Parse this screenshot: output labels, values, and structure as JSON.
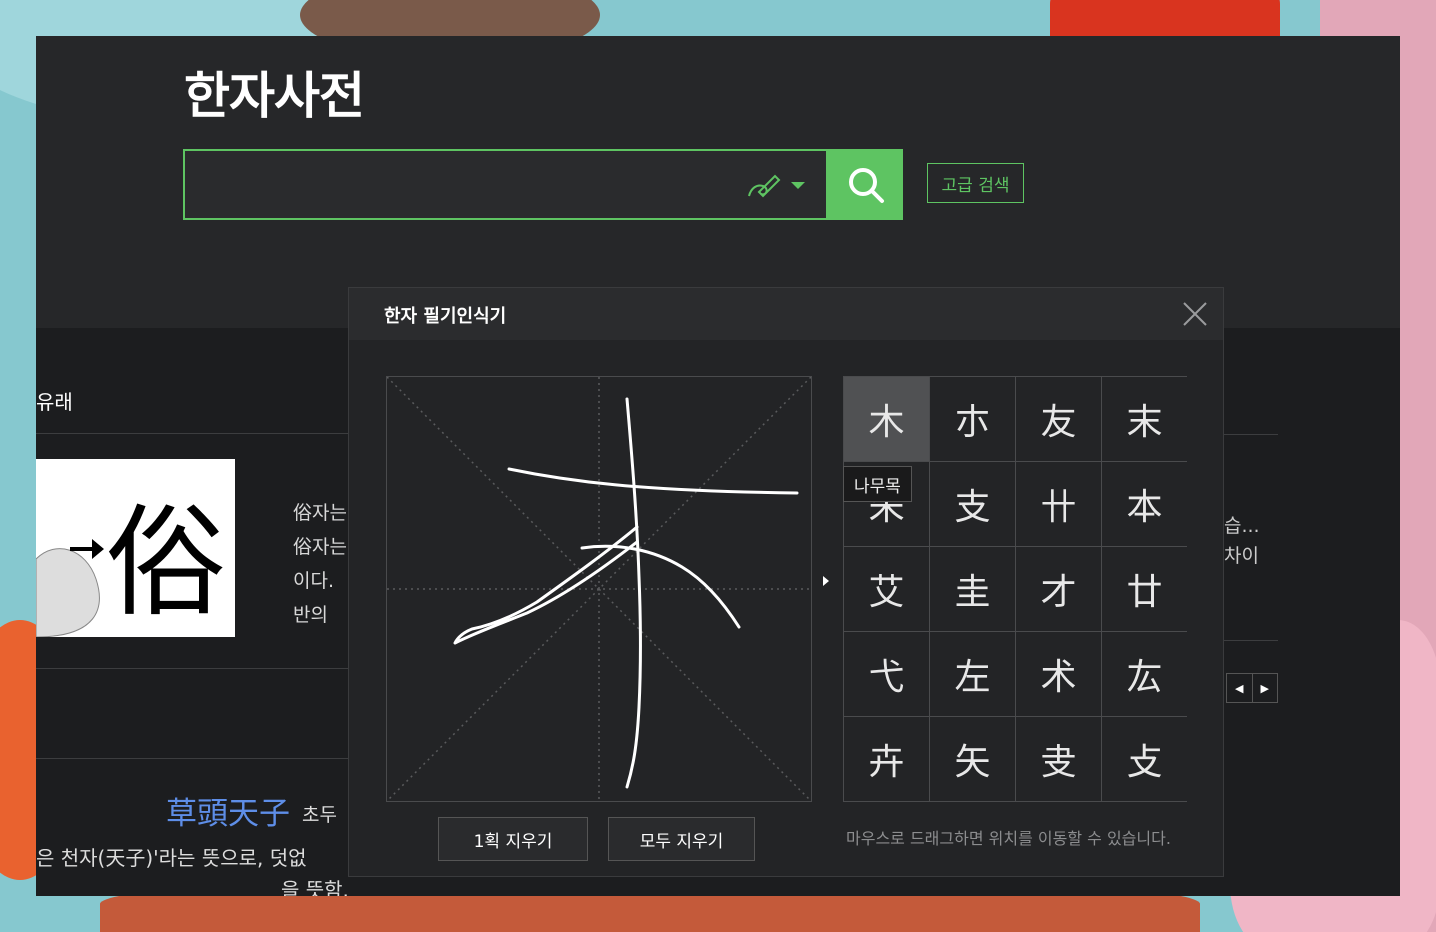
{
  "app": {
    "logo": "한자사전",
    "search": {
      "value": "",
      "placeholder": ""
    },
    "advanced_search_label": "고급 검색"
  },
  "background_content": {
    "section_label": "유래",
    "image_glyph": "俗",
    "text_lines": [
      "俗자는",
      "俗자는",
      "이다.",
      "반의"
    ],
    "hanja_phrase": "草頭天子",
    "hanja_reading": "초두",
    "meaning_line1": "은 천자(天子)'라는 뜻으로, 덧없",
    "meaning_line2": "을 뜻함.",
    "right_text_line1": "습...",
    "right_text_line2": "차이"
  },
  "modal": {
    "title": "한자 필기인식기",
    "candidates": [
      "木",
      "朩",
      "友",
      "末",
      "朱",
      "支",
      "卄",
      "本",
      "艾",
      "圭",
      "才",
      "廿",
      "弋",
      "左",
      "术",
      "厷",
      "卉",
      "矢",
      "叏",
      "攴"
    ],
    "selected_index": 0,
    "tooltip": "나무목",
    "undo_stroke_label": "1획 지우기",
    "clear_all_label": "모두 지우기",
    "hint": "마우스로 드래그하면 위치를 이동할 수 있습니다."
  },
  "colors": {
    "accent": "#5ec462",
    "hanja_link": "#5e8ee8"
  }
}
